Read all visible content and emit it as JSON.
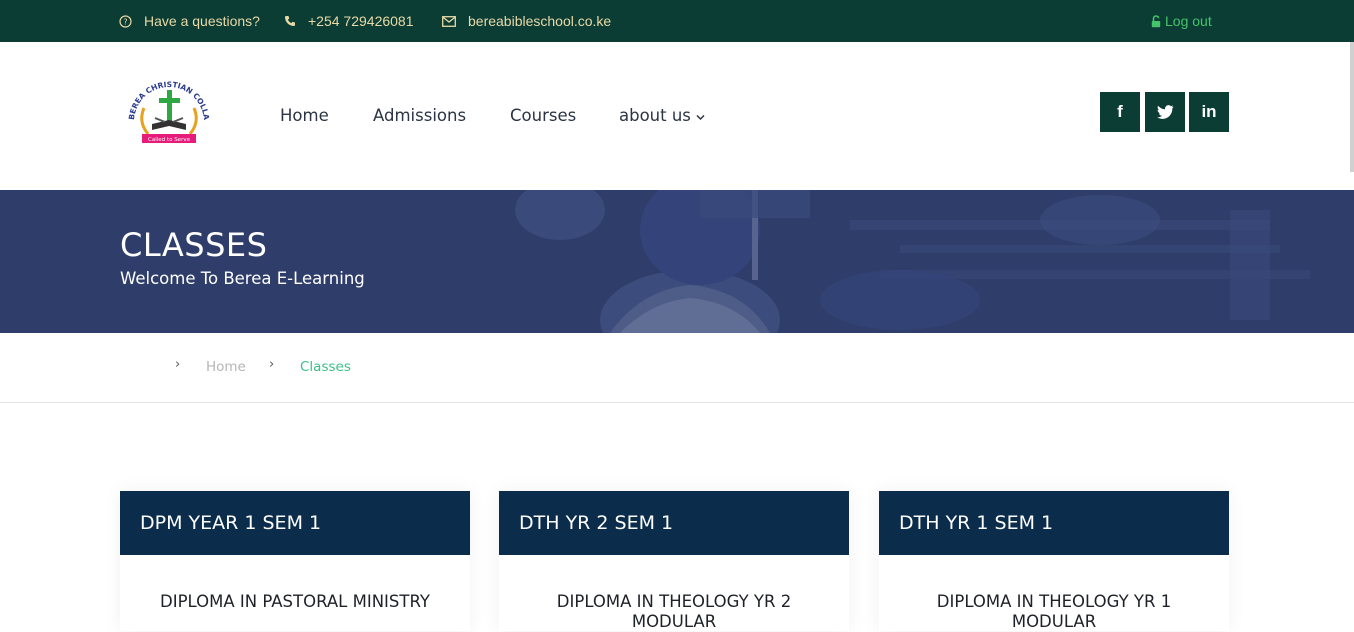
{
  "topbar": {
    "question": "Have a questions?",
    "phone": "+254 729426081",
    "email": "bereabibleschool.co.ke",
    "logout": "Log out",
    "colors": {
      "bg": "#0b3d35",
      "text": "#e8d9a6",
      "logout": "#45c46a"
    }
  },
  "logo": {
    "arc_text": "BEREA CHRISTIAN COLLAGE",
    "ribbon_text": "Called to Serve"
  },
  "nav": {
    "items": [
      {
        "label": "Home"
      },
      {
        "label": "Admissions"
      },
      {
        "label": "Courses"
      },
      {
        "label": "about us"
      }
    ]
  },
  "social": {
    "facebook": "f",
    "twitter": "twitter-icon",
    "linkedin": "in"
  },
  "hero": {
    "title": "CLASSES",
    "subtitle": "Welcome To Berea E-Learning",
    "color": "#2e3d6a"
  },
  "breadcrumb": {
    "items": [
      {
        "label": "Home"
      },
      {
        "label": "Classes"
      }
    ],
    "active_color": "#3bbf8a"
  },
  "cards": [
    {
      "title": "DPM YEAR 1 SEM 1",
      "body": "DIPLOMA IN PASTORAL MINISTRY"
    },
    {
      "title": "DTH YR 2 SEM 1",
      "body": "DIPLOMA IN THEOLOGY YR 2 MODULAR"
    },
    {
      "title": "DTH YR 1 SEM 1",
      "body": "DIPLOMA IN THEOLOGY YR 1 MODULAR"
    }
  ]
}
